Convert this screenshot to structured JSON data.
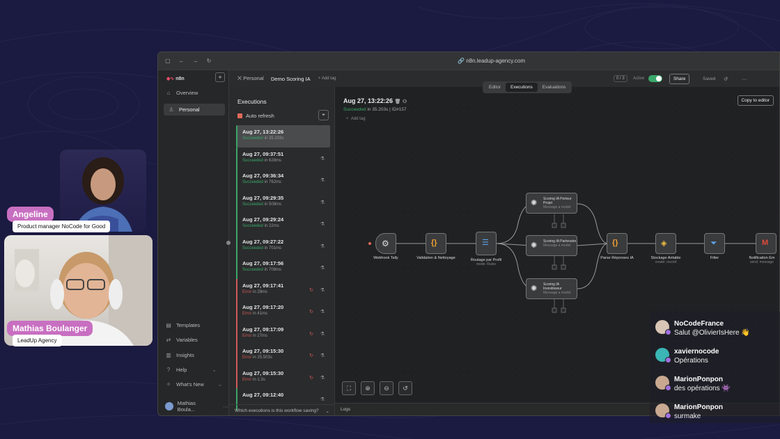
{
  "participants": [
    {
      "name": "Angeline",
      "role": "Product manager NoCode for Good"
    },
    {
      "name": "Mathias Boulanger",
      "role": "LeadUp Agency"
    }
  ],
  "browser": {
    "url": "n8n.leadup-agency.com"
  },
  "sidebar": {
    "logo": "n8n",
    "items": [
      {
        "label": "Overview",
        "icon": "home-icon"
      },
      {
        "label": "Personal",
        "icon": "user-icon"
      }
    ],
    "bottom_items": [
      {
        "label": "Templates"
      },
      {
        "label": "Variables"
      },
      {
        "label": "Insights"
      },
      {
        "label": "Help"
      },
      {
        "label": "What's New"
      }
    ],
    "user": "Mathias Boula..."
  },
  "workflow": {
    "breadcrumb_owner": "Personal",
    "name": "Demo Scoring IA",
    "add_tag": "+ Add tag",
    "version": "0 / 3",
    "active_label": "Active",
    "share_label": "Share",
    "saved_label": "Saved",
    "star_label": "St"
  },
  "tabs": [
    "Editor",
    "Executions",
    "Evaluations"
  ],
  "executions": {
    "title": "Executions",
    "auto_refresh": "Auto refresh",
    "items": [
      {
        "date": "Aug 27, 13:22:26",
        "status": "Succeeded",
        "duration": "in 35.203s",
        "ok": true,
        "selected": true
      },
      {
        "date": "Aug 27, 09:37:51",
        "status": "Succeeded",
        "duration": "in 628ms",
        "ok": true
      },
      {
        "date": "Aug 27, 09:36:34",
        "status": "Succeeded",
        "duration": "in 762ms",
        "ok": true
      },
      {
        "date": "Aug 27, 09:29:35",
        "status": "Succeeded",
        "duration": "in 508ms",
        "ok": true
      },
      {
        "date": "Aug 27, 09:29:24",
        "status": "Succeeded",
        "duration": "in 22ms",
        "ok": true
      },
      {
        "date": "Aug 27, 09:27:22",
        "status": "Succeeded",
        "duration": "in 701ms",
        "ok": true
      },
      {
        "date": "Aug 27, 09:17:56",
        "status": "Succeeded",
        "duration": "in 708ms",
        "ok": true
      },
      {
        "date": "Aug 27, 09:17:41",
        "status": "Error",
        "duration": "in 28ms",
        "ok": false
      },
      {
        "date": "Aug 27, 09:17:20",
        "status": "Error",
        "duration": "in 41ms",
        "ok": false
      },
      {
        "date": "Aug 27, 09:17:09",
        "status": "Error",
        "duration": "in 27ms",
        "ok": false
      },
      {
        "date": "Aug 27, 09:15:30",
        "status": "Error",
        "duration": "in 25.503s",
        "ok": false
      },
      {
        "date": "Aug 27, 09:15:30",
        "status": "Error",
        "duration": "in 1.3s",
        "ok": false
      },
      {
        "date": "Aug 27, 09:12:40",
        "status": "",
        "duration": "",
        "ok": true
      }
    ],
    "footer": "Which executions is this workflow saving?"
  },
  "detail": {
    "date": "Aug 27, 13:22:26",
    "status": "Succeeded",
    "duration": "in 35.203s",
    "id": "ID#157",
    "add_tag": "Add tag",
    "copy_button": "Copy to editor",
    "logs": "Logs"
  },
  "nodes": [
    {
      "label": "Webhook Tally",
      "sub": ""
    },
    {
      "label": "Validation & Nettoyage",
      "sub": ""
    },
    {
      "label": "Routage par Profil",
      "sub": "mode: Rules"
    },
    {
      "label": "Scoring IA Porteur Projet",
      "sub": "Message a model"
    },
    {
      "label": "Scoring IA Partenaire",
      "sub": "Message a model"
    },
    {
      "label": "Scoring IA Investisseur",
      "sub": "Message a model"
    },
    {
      "label": "Parse Réponses IA",
      "sub": ""
    },
    {
      "label": "Stockage Airtable",
      "sub": "create: record"
    },
    {
      "label": "Filter",
      "sub": ""
    },
    {
      "label": "Notification Em",
      "sub": "send: message"
    }
  ],
  "chat": [
    {
      "user": "NoCodeFrance",
      "text": "Salut @OlivierIsHere 👋",
      "color": "#d9c5b5"
    },
    {
      "user": "xaviernocode",
      "text": "Opérations",
      "color": "#3bb5b5"
    },
    {
      "user": "MarionPonpon",
      "text": "des opérations 👾",
      "color": "#c8a890"
    },
    {
      "user": "MarionPonpon",
      "text": "surmake",
      "color": "#c8a890"
    }
  ]
}
